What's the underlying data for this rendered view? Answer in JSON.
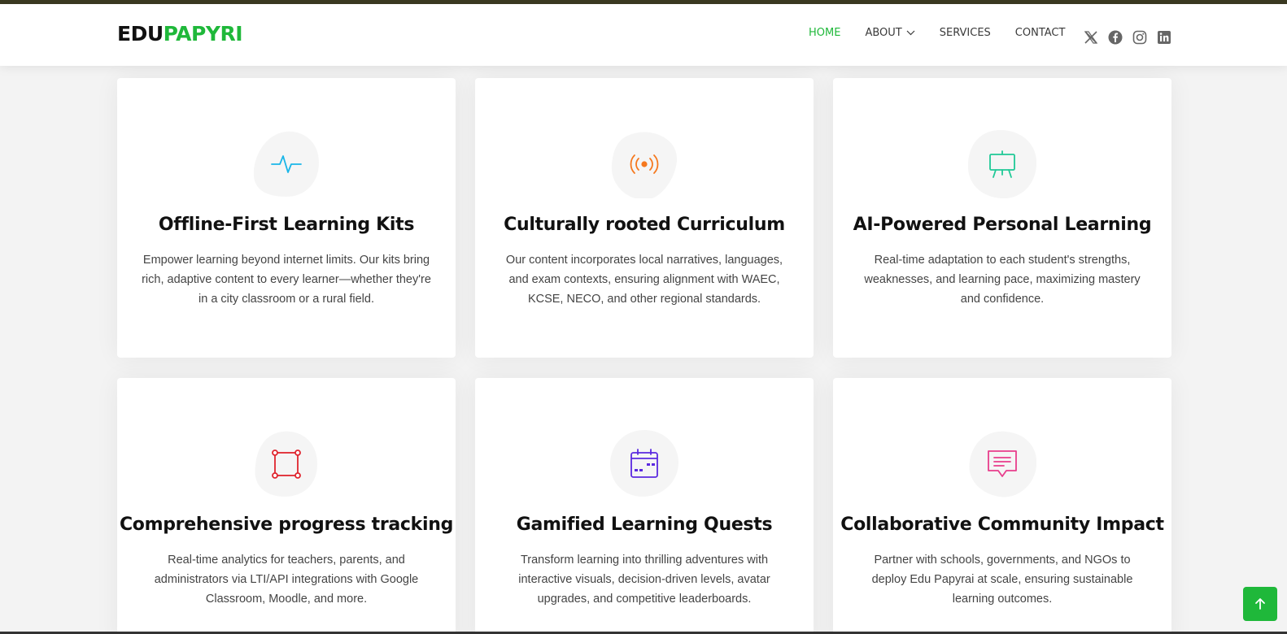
{
  "header": {
    "logo": {
      "part1": "EDU",
      "part2": "PAPYRI"
    },
    "nav": [
      {
        "label": "HOME",
        "active": true
      },
      {
        "label": "ABOUT",
        "dropdown": true
      },
      {
        "label": "SERVICES"
      },
      {
        "label": "CONTACT"
      }
    ],
    "socials": [
      "x-icon",
      "facebook-icon",
      "instagram-icon",
      "linkedin-icon"
    ]
  },
  "colors": {
    "accent": "#1fb83a",
    "blob": "#f5f5f5",
    "icon_cyan": "#1ab6e8",
    "icon_orange": "#f5781e",
    "icon_teal": "#20c997",
    "icon_red": "#e0262f",
    "icon_indigo": "#5b2ae0",
    "icon_pink": "#e83e8c"
  },
  "features": [
    {
      "icon": "activity-icon",
      "title": "Offline-First Learning Kits",
      "description": "Empower learning beyond internet limits. Our kits bring rich, adaptive content to every learner—whether they're in a city classroom or a rural field."
    },
    {
      "icon": "broadcast-icon",
      "title": "Culturally rooted Curriculum",
      "description": "Our content incorporates local narratives, languages, and exam contexts, ensuring alignment with WAEC, KCSE, NECO, and other regional standards."
    },
    {
      "icon": "easel-icon",
      "title": "AI-Powered Personal Learning",
      "description": "Real-time adaptation to each student's strengths, weaknesses, and learning pace, maximizing mastery and confidence."
    },
    {
      "icon": "bounding-box-icon",
      "title": "Comprehensive progress tracking",
      "description": "Real-time analytics for teachers, parents, and administrators via LTI/API integrations with Google Classroom, Moodle, and more."
    },
    {
      "icon": "calendar-icon",
      "title": "Gamified Learning Quests",
      "description": "Transform learning into thrilling adventures with interactive visuals, decision-driven levels, avatar upgrades, and competitive leaderboards."
    },
    {
      "icon": "chat-icon",
      "title": "Collaborative Community Impact",
      "description": "Partner with schools, governments, and NGOs to deploy Edu Papyrai at scale, ensuring sustainable learning outcomes."
    }
  ],
  "scroll_top": {
    "icon": "arrow-up-icon"
  }
}
